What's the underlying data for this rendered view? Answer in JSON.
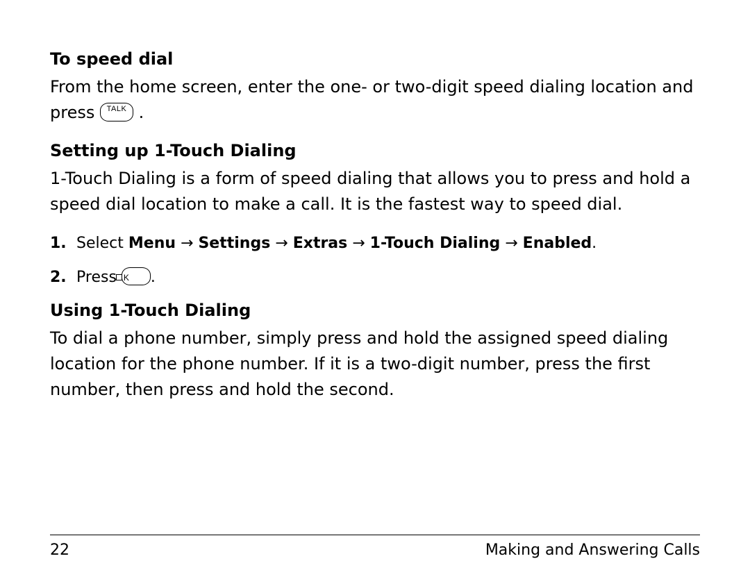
{
  "section1": {
    "heading": "To speed dial",
    "para_pre": "From the home screen, enter the one- or two-digit speed dialing location and press ",
    "key_label": "TALK",
    "para_post": " ."
  },
  "section2": {
    "heading": "Setting up 1-Touch Dialing",
    "para": "1-Touch Dialing is a form of speed dialing that allows you to press and hold a speed dial location to make a call. It is the fastest way to speed dial.",
    "step1": {
      "num": "1.",
      "lead": "Select ",
      "path_menu": "Menu",
      "path_settings": "Settings",
      "path_extras": "Extras",
      "path_touch": "1-Touch Dialing",
      "path_enabled": "Enabled",
      "arrow": " → ",
      "period": "."
    },
    "step2": {
      "num": "2.",
      "lead": "Press ",
      "key_letter": "K",
      "period": "."
    }
  },
  "section3": {
    "heading": "Using 1-Touch Dialing",
    "para": "To dial a phone number, simply press and hold the assigned speed dialing location for the phone number. If it is a two-digit number, press the first number, then press and hold the second."
  },
  "footer": {
    "page_number": "22",
    "chapter": "Making and Answering Calls"
  }
}
